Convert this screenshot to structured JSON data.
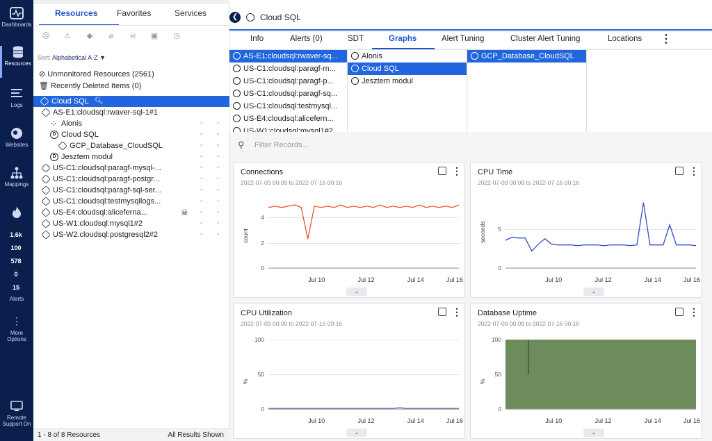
{
  "nav": {
    "items": [
      {
        "label": "Dashboards",
        "icon": "dashboards-icon"
      },
      {
        "label": "Resources",
        "icon": "resources-icon"
      },
      {
        "label": "Logs",
        "icon": "logs-icon"
      },
      {
        "label": "Websites",
        "icon": "websites-icon"
      },
      {
        "label": "Mappings",
        "icon": "mappings-icon"
      },
      {
        "label": "",
        "icon": "flame-icon"
      }
    ],
    "alert_counts": [
      {
        "value": "1.6k",
        "color": "#d9534f"
      },
      {
        "value": "100",
        "color": "#e8772e"
      },
      {
        "value": "578",
        "color": "#e8c23a"
      },
      {
        "value": "0",
        "color": "#3ab0e0"
      },
      {
        "value": "15",
        "color": "#8e44ad"
      }
    ],
    "alerts_label": "Alerts",
    "more_label": "More Options",
    "remote_label": "Remote Support On"
  },
  "left": {
    "tabs": [
      "Resources",
      "Favorites",
      "Services"
    ],
    "sort_prefix": "Sort:",
    "sort_value": "Alphabetical A-Z",
    "unmonitored": "Unmonitored Resources (2561)",
    "deleted": "Recently Deleted Items (0)",
    "tree": [
      {
        "label": "Cloud SQL",
        "indent": 0,
        "selected": true,
        "bold": false
      },
      {
        "label": "AS-E1:cloudsql:rwaver-sql-1#1",
        "indent": 1
      },
      {
        "label": "Alonis",
        "indent": 2
      },
      {
        "label": "Cloud SQL",
        "indent": 2
      },
      {
        "label": "GCP_Database_CloudSQL",
        "indent": 3
      },
      {
        "label": "Jesztem modul",
        "indent": 2
      },
      {
        "label": "US-C1:cloudsql:paragf-mysql-...",
        "indent": 1
      },
      {
        "label": "US-C1:cloudsql:paragf-postgr...",
        "indent": 1
      },
      {
        "label": "US-C1:cloudsql:paragf-sql-ser...",
        "indent": 1
      },
      {
        "label": "US-C1:cloudsql:testmysqllogs...",
        "indent": 1
      },
      {
        "label": "US-E4:cloudsql:alicefernа...",
        "indent": 1
      },
      {
        "label": "US-W1:cloudsql:mysql1#2",
        "indent": 1
      },
      {
        "label": "US-W2:cloudsql:postgresql2#2",
        "indent": 1
      }
    ],
    "dash": "-",
    "footer_count": "1 - 8 of 8 Resources",
    "footer_status": "All Results Shown"
  },
  "main": {
    "title": "Cloud SQL",
    "tabs": [
      "Info",
      "Alerts (0)",
      "SDT",
      "Graphs",
      "Alert Tuning",
      "Cluster Alert Tuning",
      "Locations"
    ],
    "active_tab": "Graphs",
    "col1": [
      "AS-E1:cloudsql:rwaver-sq...",
      "US-C1:cloudsql:paragf-m...",
      "US-C1:cloudsql:paragf-p...",
      "US-C1:cloudsql:paragf-sq...",
      "US-C1:cloudsql:testmysql...",
      "US-E4:cloudsql:alicefern...",
      "US-W1:cloudsql:mysql1#2"
    ],
    "col2": [
      "Alonis",
      "Cloud SQL",
      "Jesztem modul"
    ],
    "col3": [
      "GCP_Database_CloudSQL"
    ],
    "filter_placeholder": "Filter Records...",
    "range": "2022-07-09 00:09 to 2022-07-16 00:16"
  },
  "chart_data": [
    {
      "type": "line",
      "title": "Connections",
      "ylabel": "count",
      "yticks": [
        0,
        2,
        4
      ],
      "ylim": [
        0,
        5.5
      ],
      "xticks": [
        "Jul 10",
        "Jul 12",
        "Jul 14",
        "Jul 16"
      ],
      "color": "#e8552b",
      "series": [
        {
          "values": [
            4.8,
            4.9,
            4.8,
            4.9,
            5.0,
            4.8,
            2.3,
            4.9,
            4.8,
            4.9,
            4.8,
            5.0,
            4.8,
            4.9,
            4.8,
            4.9,
            4.8,
            5.0,
            4.8,
            4.9,
            4.8,
            4.9,
            4.8,
            5.0,
            4.8,
            4.9,
            4.8,
            4.9,
            4.8,
            5.0
          ]
        }
      ]
    },
    {
      "type": "line",
      "title": "CPU Time",
      "ylabel": "seconds",
      "yticks": [
        0,
        5
      ],
      "ylim": [
        0,
        9
      ],
      "xticks": [
        "Jul 10",
        "Jul 12",
        "Jul 14",
        "Jul 16"
      ],
      "color": "#3349c8",
      "series": [
        {
          "values": [
            3.6,
            4.0,
            3.9,
            3.9,
            2.2,
            3.1,
            3.8,
            3.1,
            3.0,
            3.0,
            3.0,
            2.9,
            3.0,
            3.0,
            3.0,
            2.9,
            3.0,
            3.0,
            3.0,
            2.9,
            3.0,
            8.5,
            3.0,
            3.0,
            3.0,
            5.6,
            3.0,
            3.0,
            3.0,
            2.9
          ]
        }
      ]
    },
    {
      "type": "line",
      "title": "CPU Utilization",
      "ylabel": "%",
      "yticks": [
        0,
        50,
        100
      ],
      "ylim": [
        0,
        100
      ],
      "xticks": [
        "Jul 10",
        "Jul 12",
        "Jul 14",
        "Jul 16"
      ],
      "color": "#7a5ca8",
      "series": [
        {
          "values": [
            1,
            1,
            1,
            1,
            1,
            1,
            1,
            1,
            1,
            1,
            1,
            1,
            1,
            1,
            1,
            1,
            1,
            1,
            1,
            1,
            2,
            1,
            1,
            1,
            1,
            1,
            1,
            1,
            1,
            1
          ]
        }
      ]
    },
    {
      "type": "area",
      "title": "Database Uptime",
      "ylabel": "%",
      "yticks": [
        0,
        50,
        100
      ],
      "ylim": [
        0,
        100
      ],
      "xticks": [
        "Jul 10",
        "Jul 12",
        "Jul 14",
        "Jul 16"
      ],
      "color": "#6d8c5c",
      "series": [
        {
          "values": [
            100,
            100,
            100,
            100,
            100,
            100,
            100,
            100,
            100,
            100,
            100,
            100,
            100,
            100,
            100,
            100,
            100,
            100,
            100,
            100,
            100,
            100,
            100,
            100,
            100,
            100,
            100,
            100,
            100,
            100
          ]
        }
      ]
    }
  ]
}
